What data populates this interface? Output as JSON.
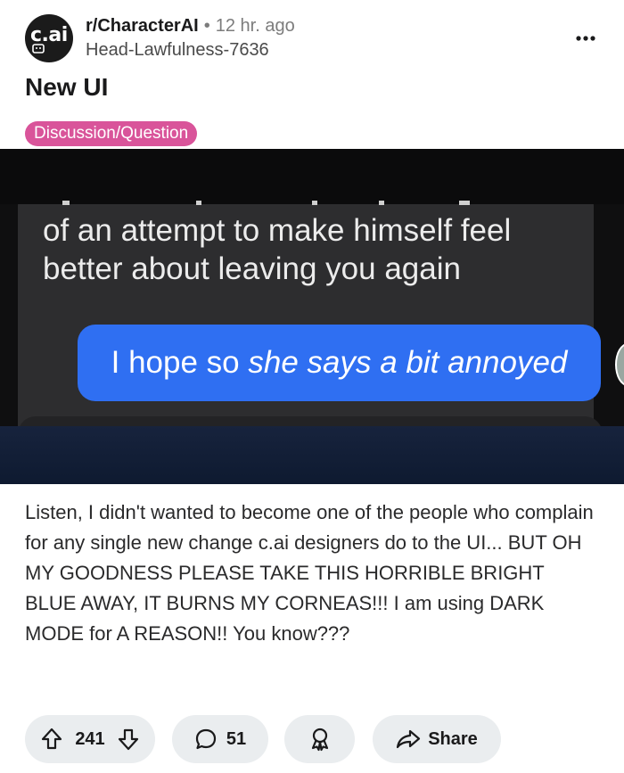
{
  "post": {
    "subreddit": "r/CharacterAI",
    "separator": "•",
    "time_ago": "12 hr. ago",
    "author": "Head-Lawfulness-7636",
    "avatar_logo": "c.ai",
    "title": "New UI",
    "flair": "Discussion/Question",
    "body": "Listen, I didn't wanted to become one of the people who complain for any single new change c.ai designers do to the UI... BUT OH MY GOODNESS PLEASE TAKE THIS HORRIBLE BRIGHT BLUE AWAY, IT BURNS MY CORNEAS!!! I am using DARK MODE for A REASON!! You know???"
  },
  "screenshot": {
    "ai_message_line1": "of an attempt to make himself feel",
    "ai_message_line2": "better about leaving you again",
    "user_message_plain": "I hope so ",
    "user_message_italic": "she says a bit annoyed"
  },
  "actions": {
    "upvotes": "241",
    "comments": "51",
    "share_label": "Share"
  },
  "icons": {
    "more": "more-options-icon",
    "upvote": "upvote-arrow-icon",
    "downvote": "downvote-arrow-icon",
    "comment": "comment-bubble-icon",
    "award": "award-icon",
    "share": "share-arrow-icon"
  },
  "colors": {
    "flair_bg": "#d9549a",
    "user_bubble": "#2f6ff2",
    "ai_bubble": "#2d2d2f",
    "action_pill": "#eaedef"
  }
}
